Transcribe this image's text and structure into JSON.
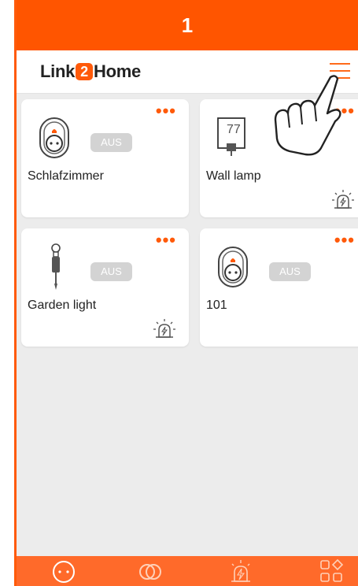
{
  "step": {
    "number": "1"
  },
  "header": {
    "logo_prefix": "Link",
    "logo_number": "2",
    "logo_suffix": "Home"
  },
  "devices": [
    {
      "name": "Schlafzimmer",
      "status": "AUS",
      "type": "socket-icon",
      "menu": "•••"
    },
    {
      "name": "Wall lamp",
      "status": "",
      "type": "thermostat-icon",
      "display": "77",
      "menu": "•••"
    },
    {
      "name": "Garden light",
      "status": "AUS",
      "type": "garden-light-icon",
      "menu": "•••"
    },
    {
      "name": "101",
      "status": "AUS",
      "type": "socket-icon",
      "menu": "•••"
    }
  ],
  "nav": [
    {
      "icon": "home-dots-icon"
    },
    {
      "icon": "link-rings-icon"
    },
    {
      "icon": "alarm-icon"
    },
    {
      "icon": "grid-apps-icon"
    }
  ],
  "colors": {
    "accent": "#ff5500",
    "background": "#ececec",
    "badge": "#d3d3d3"
  }
}
